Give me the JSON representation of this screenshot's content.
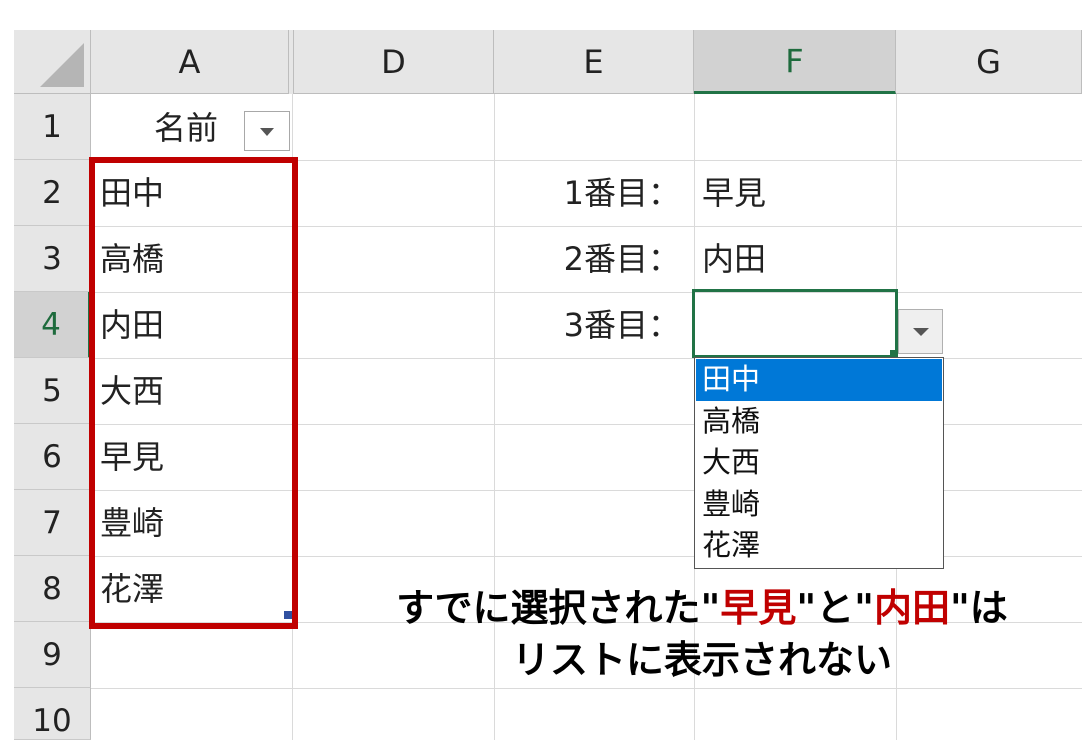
{
  "columns": {
    "a": "A",
    "d": "D",
    "e": "E",
    "f": "F",
    "g": "G"
  },
  "rows": [
    "1",
    "2",
    "3",
    "4",
    "5",
    "6",
    "7",
    "8",
    "9",
    "10"
  ],
  "header_cell": "名前",
  "names": [
    "田中",
    "高橋",
    "内田",
    "大西",
    "早見",
    "豊崎",
    "花澤"
  ],
  "labels": {
    "first": "1番目：",
    "second": "2番目：",
    "third": "3番目："
  },
  "values": {
    "first": "早見",
    "second": "内田",
    "third": ""
  },
  "dropdown": {
    "options": [
      "田中",
      "高橋",
      "大西",
      "豊崎",
      "花澤"
    ],
    "selected_index": 0
  },
  "caption": {
    "line1_a": "すでに選択された\"",
    "hl1": "早見",
    "line1_b": "\"と\"",
    "hl2": "内田",
    "line1_c": "\"は",
    "line2": "リストに表示されない"
  },
  "colors": {
    "highlight_red": "#c00000",
    "excel_green": "#217346",
    "selection_blue": "#0078d7"
  }
}
